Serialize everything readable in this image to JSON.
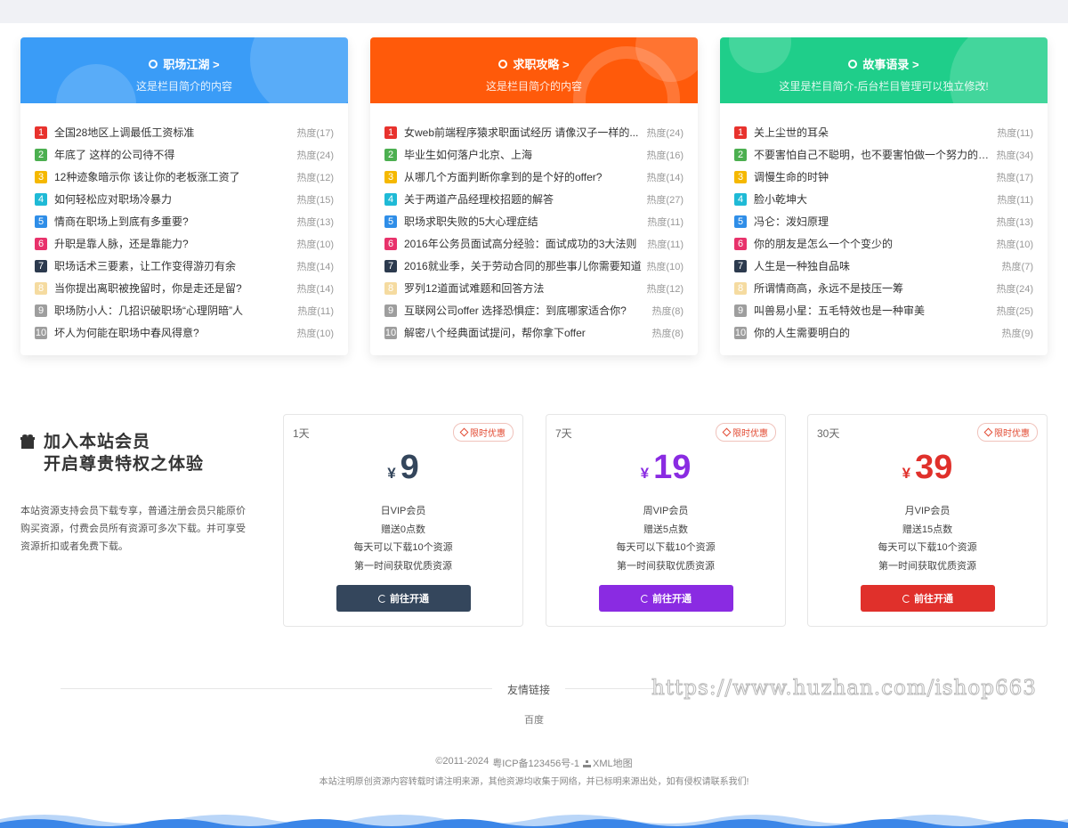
{
  "colors": {
    "rank": [
      "#e8322d",
      "#4caf50",
      "#f5b800",
      "#1fbad6",
      "#2f8ee8",
      "#e8326b",
      "#2c3a4e",
      "#f5dba0",
      "#9e9e9e",
      "#9e9e9e"
    ],
    "plan_accents": [
      "#34465c",
      "#8a2be2",
      "#e0302b"
    ]
  },
  "cards": [
    {
      "title": "职场江湖 >",
      "subtitle": "这是栏目简介的内容",
      "bg": "#3a9cf7",
      "items": [
        {
          "n": "1",
          "title": "全国28地区上调最低工资标准",
          "hot": "热度(17)"
        },
        {
          "n": "2",
          "title": "年底了 这样的公司待不得",
          "hot": "热度(24)"
        },
        {
          "n": "3",
          "title": "12种迹象暗示你 该让你的老板涨工资了",
          "hot": "热度(12)"
        },
        {
          "n": "4",
          "title": "如何轻松应对职场冷暴力",
          "hot": "热度(15)"
        },
        {
          "n": "5",
          "title": "情商在职场上到底有多重要?",
          "hot": "热度(13)"
        },
        {
          "n": "6",
          "title": "升职是靠人脉，还是靠能力?",
          "hot": "热度(10)"
        },
        {
          "n": "7",
          "title": "职场话术三要素，让工作变得游刃有余",
          "hot": "热度(14)"
        },
        {
          "n": "8",
          "title": "当你提出离职被挽留时，你是走还是留?",
          "hot": "热度(14)"
        },
        {
          "n": "9",
          "title": "职场防小人：几招识破职场“心理阴暗”人",
          "hot": "热度(11)"
        },
        {
          "n": "10",
          "title": "坏人为何能在职场中春风得意?",
          "hot": "热度(10)"
        }
      ]
    },
    {
      "title": "求职攻略 >",
      "subtitle": "这是栏目简介的内容",
      "bg": "#ff5a0a",
      "items": [
        {
          "n": "1",
          "title": "女web前端程序猿求职面试经历 请像汉子一样的...",
          "hot": "热度(24)"
        },
        {
          "n": "2",
          "title": "毕业生如何落户北京、上海",
          "hot": "热度(16)"
        },
        {
          "n": "3",
          "title": "从哪几个方面判断你拿到的是个好的offer?",
          "hot": "热度(14)"
        },
        {
          "n": "4",
          "title": "关于两道产品经理校招题的解答",
          "hot": "热度(27)"
        },
        {
          "n": "5",
          "title": "职场求职失败的5大心理症结",
          "hot": "热度(11)"
        },
        {
          "n": "6",
          "title": "2016年公务员面试高分经验：面试成功的3大法则",
          "hot": "热度(11)"
        },
        {
          "n": "7",
          "title": "2016就业季，关于劳动合同的那些事儿你需要知道",
          "hot": "热度(10)"
        },
        {
          "n": "8",
          "title": "罗列12道面试难题和回答方法",
          "hot": "热度(12)"
        },
        {
          "n": "9",
          "title": "互联网公司offer 选择恐惧症：到底哪家适合你?",
          "hot": "热度(8)"
        },
        {
          "n": "10",
          "title": "解密八个经典面试提问，帮你拿下offer",
          "hot": "热度(8)"
        }
      ]
    },
    {
      "title": "故事语录 >",
      "subtitle": "这里是栏目简介-后台栏目管理可以独立修改!",
      "bg": "#1fce8a",
      "items": [
        {
          "n": "1",
          "title": "关上尘世的耳朵",
          "hot": "热度(11)"
        },
        {
          "n": "2",
          "title": "不要害怕自己不聪明，也不要害怕做一个努力的普...",
          "hot": "热度(34)"
        },
        {
          "n": "3",
          "title": "调慢生命的时钟",
          "hot": "热度(17)"
        },
        {
          "n": "4",
          "title": "脸小乾坤大",
          "hot": "热度(11)"
        },
        {
          "n": "5",
          "title": "冯仑：泼妇原理",
          "hot": "热度(13)"
        },
        {
          "n": "6",
          "title": "你的朋友是怎么一个个变少的",
          "hot": "热度(10)"
        },
        {
          "n": "7",
          "title": "人生是一种独自品味",
          "hot": "热度(7)"
        },
        {
          "n": "8",
          "title": "所谓情商高，永远不是技压一筹",
          "hot": "热度(24)"
        },
        {
          "n": "9",
          "title": "叫兽易小星：五毛特效也是一种审美",
          "hot": "热度(25)"
        },
        {
          "n": "10",
          "title": "你的人生需要明白的",
          "hot": "热度(9)"
        }
      ]
    }
  ],
  "vip": {
    "heading_line1": "加入本站会员",
    "heading_line2": "开启尊贵特权之体验",
    "gift_icon": "gift-icon",
    "description": "本站资源支持会员下载专享，普通注册会员只能原价购买资源，付费会员所有资源可多次下载。并可享受资源折扣或者免费下载。",
    "plans": [
      {
        "days": "1天",
        "badge": "限时优惠",
        "currency": "¥",
        "price": "9",
        "lines": [
          "日VIP会员",
          "赠送0点数",
          "每天可以下载10个资源",
          "第一时间获取优质资源"
        ],
        "button": "前往开通"
      },
      {
        "days": "7天",
        "badge": "限时优惠",
        "currency": "¥",
        "price": "19",
        "lines": [
          "周VIP会员",
          "赠送5点数",
          "每天可以下载10个资源",
          "第一时间获取优质资源"
        ],
        "button": "前往开通"
      },
      {
        "days": "30天",
        "badge": "限时优惠",
        "currency": "¥",
        "price": "39",
        "lines": [
          "月VIP会员",
          "赠送15点数",
          "每天可以下载10个资源",
          "第一时间获取优质资源"
        ],
        "button": "前往开通"
      }
    ]
  },
  "links": {
    "title": "友情链接",
    "items": [
      "百度"
    ],
    "watermark": "https://www.huzhan.com/ishop663"
  },
  "footer": {
    "copyright": "©2011-2024",
    "icp": "粤ICP备123456号-1",
    "sitemap": "XML地图",
    "notice": "本站注明原创资源内容转载时请注明来源，其他资源均收集于网络，并已标明来源出处，如有侵权请联系我们!"
  }
}
